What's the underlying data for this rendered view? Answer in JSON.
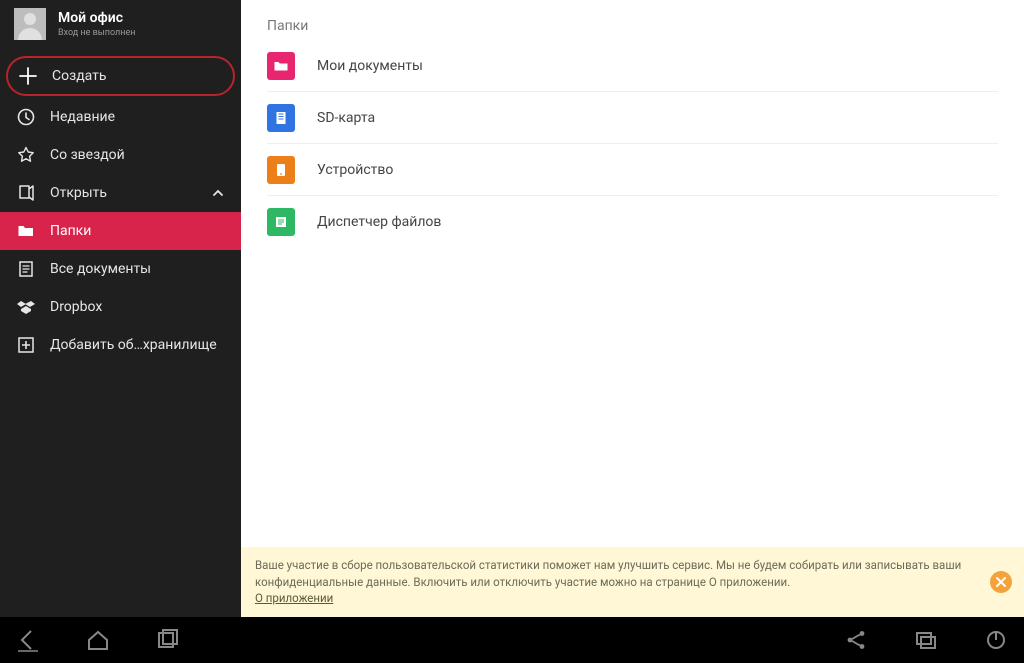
{
  "user": {
    "name": "Мой офис",
    "status": "Вход не выполнен"
  },
  "sidebar": {
    "create": "Создать",
    "recent": "Недавние",
    "starred": "Со звездой",
    "open": "Открыть",
    "folders": "Папки",
    "all_docs": "Все документы",
    "dropbox": "Dropbox",
    "add_storage": "Добавить об…хранилище"
  },
  "content": {
    "header": "Папки",
    "items": [
      {
        "label": "Мои документы",
        "color": "#e8266f",
        "glyph": "folder"
      },
      {
        "label": "SD-карта",
        "color": "#2f74e0",
        "glyph": "doc"
      },
      {
        "label": "Устройство",
        "color": "#ed7f1a",
        "glyph": "device"
      },
      {
        "label": "Диспетчер файлов",
        "color": "#2fb863",
        "glyph": "files"
      }
    ]
  },
  "banner": {
    "text": "Ваше участие в сборе пользовательской статистики поможет нам улучшить сервис. Мы не будем собирать или записывать ваши конфиденциальные данные. Включить или отключить участие можно на странице О приложении.",
    "link": "О приложении"
  }
}
